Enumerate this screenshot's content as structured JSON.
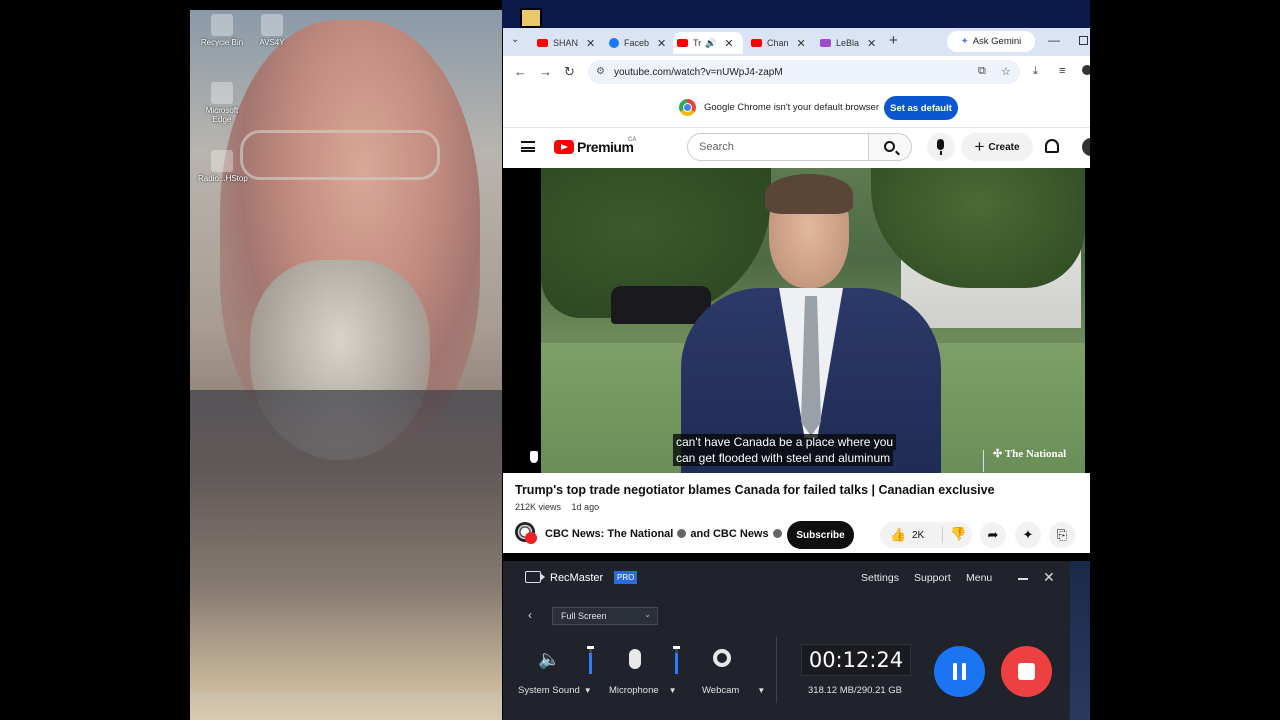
{
  "desktop": {
    "icons": [
      "Recycle Bin",
      "AVS4Y",
      "Microsoft Edge",
      "Radio...HStop"
    ]
  },
  "browser": {
    "tabs": [
      {
        "label": "SHAN",
        "icon": "youtube-icon",
        "color": "#ff0000"
      },
      {
        "label": "Faceb",
        "icon": "facebook-icon",
        "color": "#1877f2"
      },
      {
        "label": "Tr",
        "icon": "youtube-icon",
        "color": "#ff0000",
        "active": true
      },
      {
        "label": "Chan",
        "icon": "youtube-icon",
        "color": "#ff0000"
      },
      {
        "label": "LeBla",
        "icon": "butterfly-icon",
        "color": "#9b4dca"
      }
    ],
    "gemini_label": "Ask Gemini",
    "url": "youtube.com/watch?v=nUWpJ4-zapM",
    "infobar": {
      "message": "Google Chrome isn't your default browser",
      "button": "Set as default"
    }
  },
  "youtube": {
    "logo_text": "Premium",
    "country": "CA",
    "search_placeholder": "Search",
    "create_label": "Create",
    "subtitles": [
      "can't have Canada be a place where you",
      "can get flooded with steel and aluminum"
    ],
    "watermark": "The National",
    "video_title": "Trump's top trade negotiator blames Canada for failed talks | Canadian exclusive",
    "views": "212K views",
    "age": "1d ago",
    "channel_a": "CBC News: The National",
    "channel_joiner": "and",
    "channel_b": "CBC News",
    "subscribe_label": "Subscribe",
    "likes": "2K"
  },
  "recmaster": {
    "app_name": "RecMaster",
    "badge": "PRO",
    "menu": [
      "Settings",
      "Support",
      "Menu"
    ],
    "mode": "Full Screen",
    "sources": [
      {
        "label": "System Sound",
        "icon": "speaker-icon"
      },
      {
        "label": "Microphone",
        "icon": "microphone-icon"
      },
      {
        "label": "Webcam",
        "icon": "webcam-icon"
      }
    ],
    "timer": "00:12:24",
    "size": "318.12 MB/290.21 GB"
  },
  "colors": {
    "youtube_red": "#ff0000",
    "chrome_blue": "#0b57d0",
    "rec_pause": "#1b74f2",
    "rec_stop": "#ee4040"
  }
}
